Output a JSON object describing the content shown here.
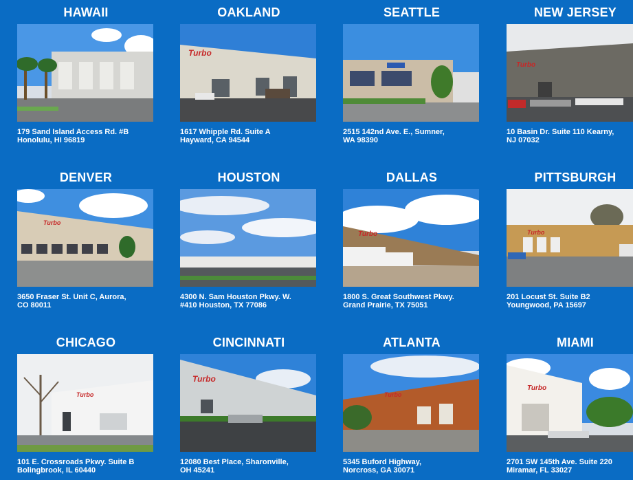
{
  "locations": [
    {
      "city": "HAWAII",
      "address": "179 Sand Island Access Rd. #B\nHonolulu, HI 96819"
    },
    {
      "city": "OAKLAND",
      "address": "1617 Whipple Rd. Suite A\nHayward, CA 94544"
    },
    {
      "city": "SEATTLE",
      "address": "2515 142nd Ave. E., Sumner,\nWA 98390"
    },
    {
      "city": "NEW JERSEY",
      "address": "10 Basin Dr. Suite 110 Kearny,\nNJ 07032"
    },
    {
      "city": "DENVER",
      "address": "3650 Fraser St. Unit C, Aurora,\nCO 80011"
    },
    {
      "city": "HOUSTON",
      "address": "4300 N. Sam Houston Pkwy. W.\n#410 Houston, TX 77086"
    },
    {
      "city": "DALLAS",
      "address": "1800 S. Great Southwest Pkwy.\nGrand Prairie, TX 75051"
    },
    {
      "city": "PITTSBURGH",
      "address": "201 Locust St. Suite B2\nYoungwood, PA 15697"
    },
    {
      "city": "CHICAGO",
      "address": "101 E. Crossroads Pkwy. Suite B\nBolingbrook, IL 60440"
    },
    {
      "city": "CINCINNATI",
      "address": "12080 Best Place, Sharonville,\nOH 45241"
    },
    {
      "city": "ATLANTA",
      "address": "5345 Buford Highway,\nNorcross, GA 30071"
    },
    {
      "city": "MIAMI",
      "address": "2701 SW 145th Ave. Suite 220\nMiramar, FL 33027"
    }
  ],
  "logo_text": "Turbo",
  "colors": {
    "background": "#0a6cc4",
    "sky": "#3f8fe0",
    "ground": "#55585c",
    "building": "#d8d2c4"
  }
}
